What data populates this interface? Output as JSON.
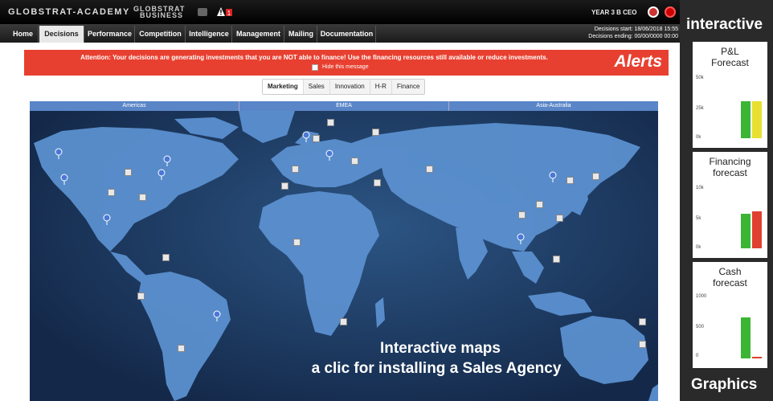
{
  "topbar": {
    "brand": "GLOBSTRAT-ACADEMY",
    "brand2_line1": "GLOBSTRAT",
    "brand2_line2": "BUSINESS",
    "alert_count": "1",
    "year": "YEAR 3  B  CEO"
  },
  "nav": {
    "tabs": [
      "Home",
      "Decisions",
      "Performance",
      "Competition",
      "Intelligence",
      "Management",
      "Mailing",
      "Documentation"
    ],
    "active": "Decisions",
    "decisions_start": "Decisions start: 18/06/2018 15:55",
    "decisions_ending": "Decisions ending: 00/00/0000 00:00"
  },
  "alert": {
    "message": "Attention: Your decisions are generating investments that you are NOT able to finance! Use the financing resources still available or reduce investments.",
    "hide_label": "Hide this message",
    "annotation": "Alerts"
  },
  "subtabs": [
    "Marketing",
    "Sales",
    "Innovation",
    "H-R",
    "Finance"
  ],
  "subtabs_active": "Marketing",
  "regions": [
    "Americas",
    "EMEA",
    "Asia-Australia"
  ],
  "map": {
    "caption1": "Interactive maps",
    "caption2": "a clic for installing a Sales Agency"
  },
  "sidebar": {
    "top_label": "interactive",
    "bottom_label": "Graphics",
    "charts": [
      {
        "title1": "P&L",
        "title2": "Forecast",
        "ticks": [
          "50k",
          "25k",
          "0k"
        ],
        "bars": [
          {
            "color": "#3cb534",
            "value": 0.62
          },
          {
            "color": "#e8e030",
            "value": 0.62
          }
        ]
      },
      {
        "title1": "Financing",
        "title2": "forecast",
        "ticks": [
          "10k",
          "5k",
          "0k"
        ],
        "bars": [
          {
            "color": "#3cb534",
            "value": 0.58
          },
          {
            "color": "#e04030",
            "value": 0.62
          }
        ]
      },
      {
        "title1": "Cash",
        "title2": "forecast",
        "ticks": [
          "1000",
          "500",
          "0"
        ],
        "bars": [
          {
            "color": "#3cb534",
            "value": 0.68
          },
          {
            "color": "#e04030",
            "value": 0.02
          }
        ]
      }
    ]
  },
  "colors": {
    "alert": "#e84030",
    "region_header": "#5a86c8",
    "map_bg": "#1e3d66",
    "land": "#5b90cf"
  }
}
